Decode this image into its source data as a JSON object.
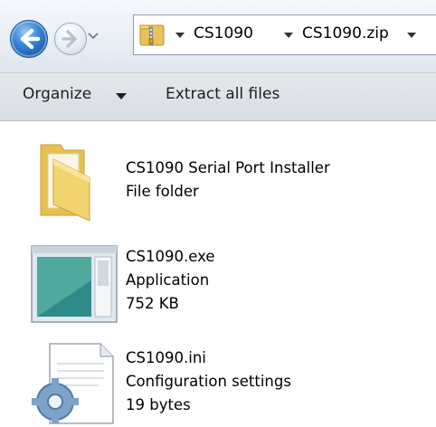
{
  "address_bar": {
    "breadcrumbs": [
      "CS1090",
      "CS1090.zip"
    ]
  },
  "toolbar": {
    "organize_label": "Organize",
    "extract_label": "Extract all files"
  },
  "files": [
    {
      "name": "CS1090 Serial Port Installer",
      "type": "File folder",
      "icon": "folder-icon"
    },
    {
      "name": "CS1090.exe",
      "type": "Application",
      "size": "752 KB",
      "icon": "application-icon"
    },
    {
      "name": "CS1090.ini",
      "type": "Configuration settings",
      "size": "19 bytes",
      "icon": "configuration-file-icon"
    }
  ],
  "colors": {
    "nav_button_blue": "#2f74c6",
    "toolbar_bg": "#dde1e7",
    "folder_yellow": "#f3d676"
  }
}
